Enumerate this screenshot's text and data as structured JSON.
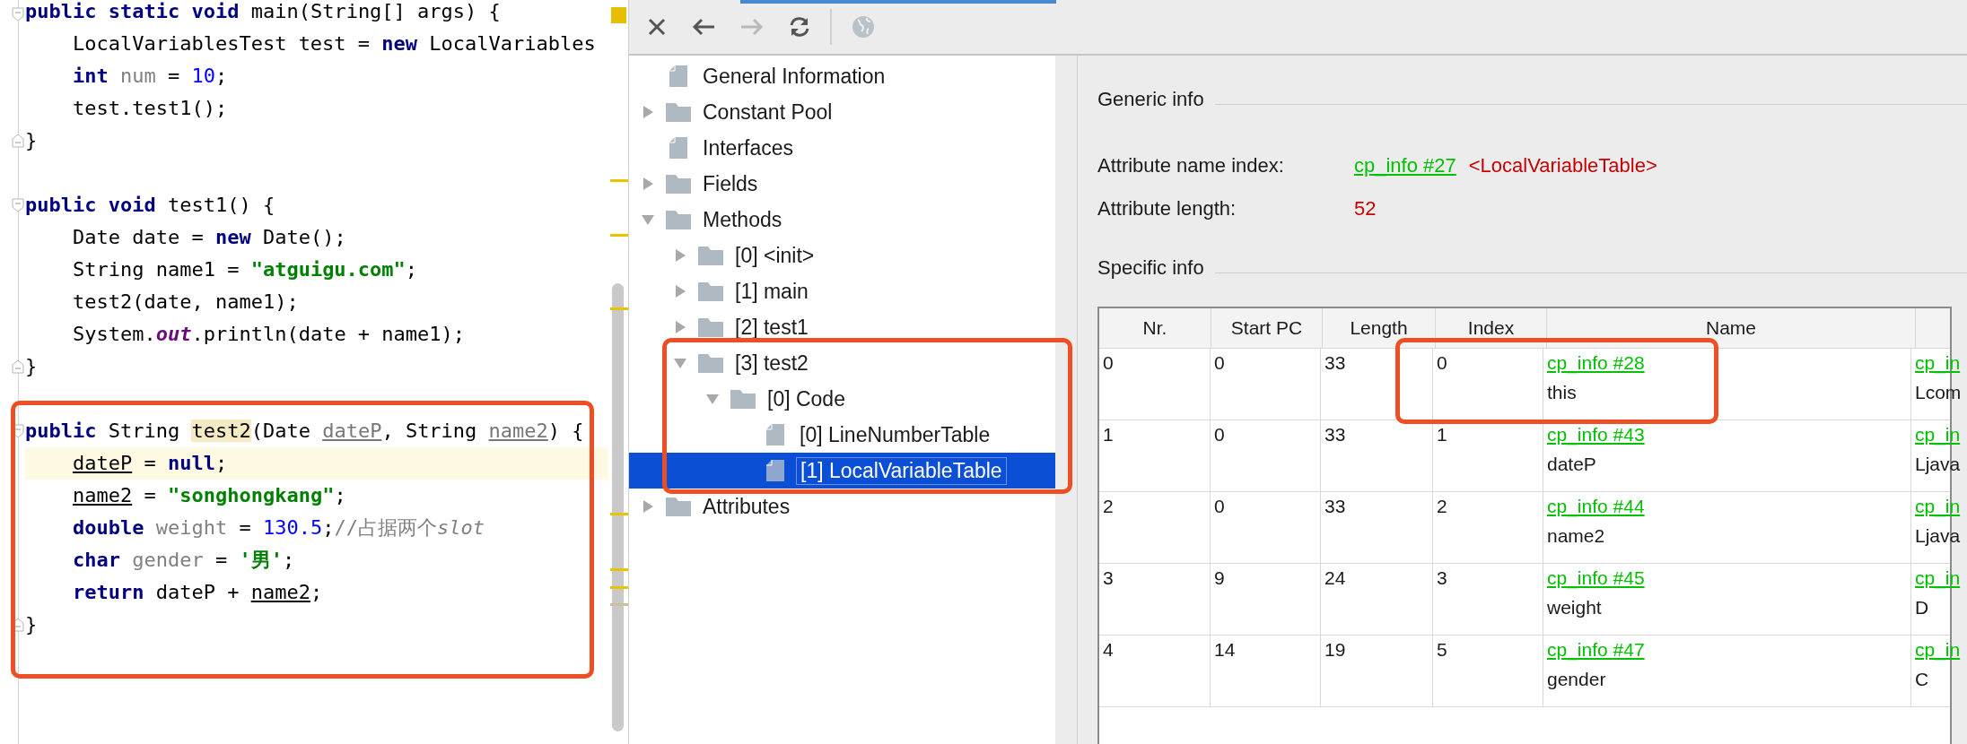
{
  "editor": {
    "lines": [
      {
        "kind": "block",
        "highlighted": false,
        "segments": [
          {
            "kind": "keyword",
            "text": "public static void "
          },
          {
            "kind": "plain",
            "text": "main(String[] args) {"
          }
        ],
        "children": [
          {
            "kind": "statement",
            "highlighted": false,
            "segments": [
              {
                "kind": "plain",
                "text": "LocalVariablesTest test = "
              },
              {
                "kind": "keyword",
                "text": "new "
              },
              {
                "kind": "plain",
                "text": "LocalVariables"
              }
            ]
          },
          {
            "kind": "statement",
            "highlighted": false,
            "segments": [
              {
                "kind": "keyword",
                "text": "int "
              },
              {
                "kind": "unused",
                "text": "num"
              },
              {
                "kind": "plain",
                "text": " = "
              },
              {
                "kind": "number",
                "text": "10"
              },
              {
                "kind": "plain",
                "text": ";"
              }
            ]
          },
          {
            "kind": "statement",
            "highlighted": false,
            "segments": [
              {
                "kind": "plain",
                "text": "test.test1();"
              }
            ]
          }
        ]
      },
      {
        "kind": "block-end",
        "highlighted": false,
        "segments": [
          {
            "kind": "plain",
            "text": "}"
          }
        ]
      },
      {
        "kind": "blank",
        "highlighted": false
      },
      {
        "kind": "block",
        "highlighted": false,
        "segments": [
          {
            "kind": "keyword",
            "text": "public void "
          },
          {
            "kind": "plain",
            "text": "test1() {"
          }
        ],
        "children": [
          {
            "kind": "statement",
            "highlighted": false,
            "segments": [
              {
                "kind": "plain",
                "text": "Date date = "
              },
              {
                "kind": "keyword",
                "text": "new "
              },
              {
                "kind": "plain",
                "text": "Date();"
              }
            ]
          },
          {
            "kind": "statement",
            "highlighted": false,
            "segments": [
              {
                "kind": "plain",
                "text": "String name1 = "
              },
              {
                "kind": "string",
                "text": "\"atguigu.com\""
              },
              {
                "kind": "plain",
                "text": ";"
              }
            ]
          },
          {
            "kind": "statement",
            "highlighted": false,
            "segments": [
              {
                "kind": "plain",
                "text": "test2(date, name1);"
              }
            ]
          },
          {
            "kind": "statement",
            "highlighted": false,
            "segments": [
              {
                "kind": "plain",
                "text": "System."
              },
              {
                "kind": "static-field",
                "text": "out"
              },
              {
                "kind": "plain",
                "text": ".println(date + name1);"
              }
            ]
          }
        ]
      },
      {
        "kind": "block-end",
        "highlighted": false,
        "segments": [
          {
            "kind": "plain",
            "text": "}"
          }
        ]
      },
      {
        "kind": "blank",
        "highlighted": false
      },
      {
        "kind": "block",
        "highlighted": false,
        "segments": [
          {
            "kind": "keyword",
            "text": "public "
          },
          {
            "kind": "plain",
            "text": "String "
          },
          {
            "kind": "method-mark",
            "text": "test2"
          },
          {
            "kind": "plain",
            "text": "(Date "
          },
          {
            "kind": "param-decl",
            "text": "dateP"
          },
          {
            "kind": "plain",
            "text": ", String "
          },
          {
            "kind": "param-decl",
            "text": "name2"
          },
          {
            "kind": "plain",
            "text": ") {"
          }
        ],
        "children": [
          {
            "kind": "statement",
            "highlighted": true,
            "segments": [
              {
                "kind": "param",
                "text": "dateP"
              },
              {
                "kind": "plain",
                "text": " = "
              },
              {
                "kind": "keyword",
                "text": "null"
              },
              {
                "kind": "plain",
                "text": ";"
              }
            ]
          },
          {
            "kind": "statement",
            "highlighted": false,
            "segments": [
              {
                "kind": "param",
                "text": "name2"
              },
              {
                "kind": "plain",
                "text": " = "
              },
              {
                "kind": "string",
                "text": "\"songhongkang\""
              },
              {
                "kind": "plain",
                "text": ";"
              }
            ]
          },
          {
            "kind": "statement",
            "highlighted": false,
            "segments": [
              {
                "kind": "keyword",
                "text": "double "
              },
              {
                "kind": "unused",
                "text": "weight"
              },
              {
                "kind": "plain",
                "text": " = "
              },
              {
                "kind": "number",
                "text": "130.5"
              },
              {
                "kind": "plain",
                "text": ";"
              },
              {
                "kind": "comment",
                "text": "//占据两个"
              },
              {
                "kind": "comment-italic",
                "text": "slot"
              }
            ]
          },
          {
            "kind": "statement",
            "highlighted": false,
            "segments": [
              {
                "kind": "keyword",
                "text": "char "
              },
              {
                "kind": "unused",
                "text": "gender"
              },
              {
                "kind": "plain",
                "text": " = "
              },
              {
                "kind": "string",
                "text": "'男'"
              },
              {
                "kind": "plain",
                "text": ";"
              }
            ]
          },
          {
            "kind": "statement",
            "highlighted": false,
            "segments": [
              {
                "kind": "keyword",
                "text": "return "
              },
              {
                "kind": "plain",
                "text": "dateP + "
              },
              {
                "kind": "param",
                "text": "name2"
              },
              {
                "kind": "plain",
                "text": ";"
              }
            ]
          }
        ]
      },
      {
        "kind": "block-end",
        "highlighted": false,
        "segments": [
          {
            "kind": "plain",
            "text": "}"
          }
        ]
      }
    ]
  },
  "toolbar": [
    {
      "kind": "close",
      "disabled": false
    },
    {
      "kind": "back",
      "disabled": false
    },
    {
      "kind": "forward",
      "disabled": true
    },
    {
      "kind": "refresh",
      "disabled": false
    },
    {
      "kind": "globe",
      "disabled": true
    }
  ],
  "tree": [
    {
      "label": "General Information",
      "kind": "file",
      "selected": false
    },
    {
      "label": "Constant Pool",
      "kind": "folder",
      "expanded": false,
      "selected": false
    },
    {
      "label": "Interfaces",
      "kind": "file",
      "selected": false
    },
    {
      "label": "Fields",
      "kind": "folder",
      "expanded": false,
      "selected": false
    },
    {
      "label": "Methods",
      "kind": "folder",
      "expanded": true,
      "selected": false,
      "children": [
        {
          "label": "[0] <init>",
          "kind": "folder",
          "expanded": false,
          "selected": false
        },
        {
          "label": "[1] main",
          "kind": "folder",
          "expanded": false,
          "selected": false
        },
        {
          "label": "[2] test1",
          "kind": "folder",
          "expanded": false,
          "selected": false
        },
        {
          "label": "[3] test2",
          "kind": "folder",
          "expanded": true,
          "selected": false,
          "children": [
            {
              "label": "[0] Code",
              "kind": "folder",
              "expanded": true,
              "selected": false,
              "children": [
                {
                  "label": "[0] LineNumberTable",
                  "kind": "file",
                  "selected": false
                },
                {
                  "label": "[1] LocalVariableTable",
                  "kind": "file",
                  "selected": true
                }
              ]
            }
          ]
        }
      ]
    },
    {
      "label": "Attributes",
      "kind": "folder",
      "expanded": false,
      "selected": false
    }
  ],
  "details": {
    "generic_info": {
      "title": "Generic info",
      "attributes": [
        {
          "label": "Attribute name index:",
          "link": "cp_info #27",
          "value": "<LocalVariableTable>"
        },
        {
          "label": "Attribute length:",
          "value": "52"
        }
      ]
    },
    "specific_info": {
      "title": "Specific info",
      "table": {
        "columns": [
          "Nr.",
          "Start PC",
          "Length",
          "Index",
          "Name"
        ],
        "rows": [
          {
            "nr": "0",
            "start_pc": "0",
            "length": "33",
            "index": "0",
            "name_link": "cp_info #28",
            "name": "this",
            "column_6_link": "cp_in",
            "column_6": "Lcom"
          },
          {
            "nr": "1",
            "start_pc": "0",
            "length": "33",
            "index": "1",
            "name_link": "cp_info #43",
            "name": "dateP",
            "column_6_link": "cp_in",
            "column_6": "Ljava"
          },
          {
            "nr": "2",
            "start_pc": "0",
            "length": "33",
            "index": "2",
            "name_link": "cp_info #44",
            "name": "name2",
            "column_6_link": "cp_in",
            "column_6": "Ljava"
          },
          {
            "nr": "3",
            "start_pc": "9",
            "length": "24",
            "index": "3",
            "name_link": "cp_info #45",
            "name": "weight",
            "column_6_link": "cp_in",
            "column_6": "D"
          },
          {
            "nr": "4",
            "start_pc": "14",
            "length": "19",
            "index": "5",
            "name_link": "cp_info #47",
            "name": "gender",
            "column_6_link": "cp_in",
            "column_6": "C"
          }
        ]
      }
    }
  }
}
